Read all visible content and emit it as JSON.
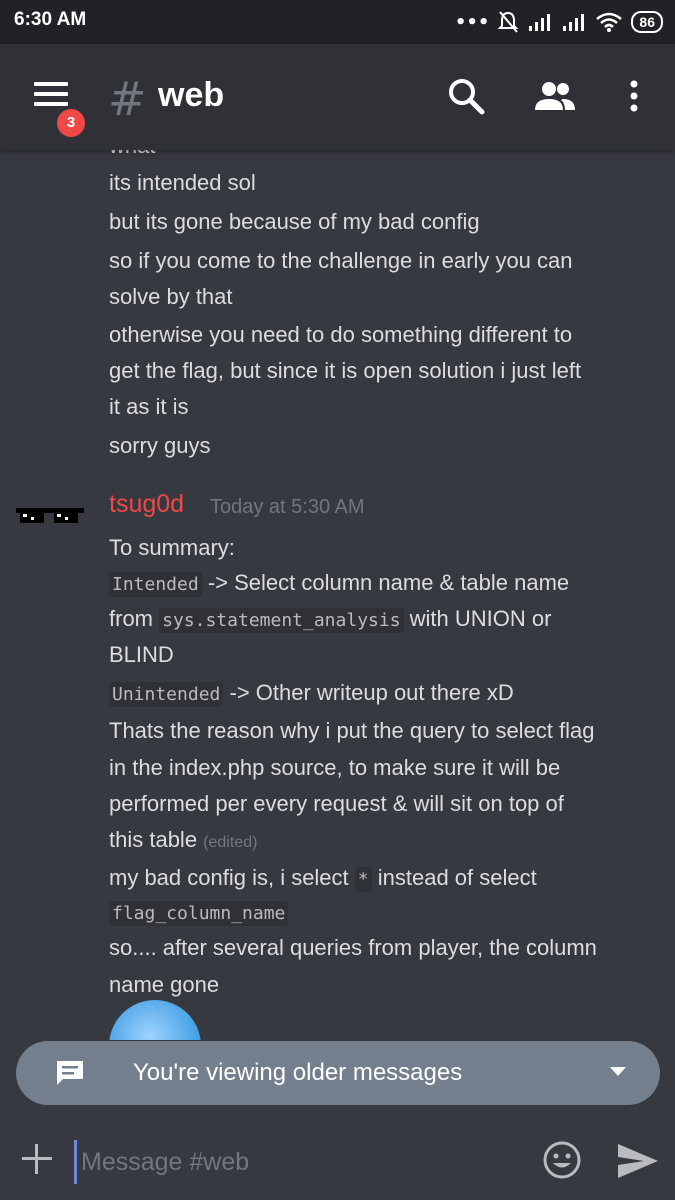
{
  "status_bar": {
    "time": "6:30 AM",
    "battery": "86"
  },
  "toolbar": {
    "badge_count": "3",
    "hash": "#",
    "channel": "web",
    "icons": [
      "menu-icon",
      "search-icon",
      "members-icon",
      "more-vertical-icon"
    ]
  },
  "messages": {
    "previous": {
      "lines": [
        "what",
        "its intended sol",
        "but its gone because of my bad config",
        "so if you come to the challenge in early you can",
        "solve by that",
        "otherwise you need to do something different to",
        "get the flag, but since it is open solution i just left",
        "it as it is",
        "sorry guys"
      ]
    },
    "group": {
      "author": "tsug0d",
      "timestamp": "Today at 5:30 AM",
      "lines": {
        "l1": "To summary:",
        "l2_code": "Intended",
        "l2_rest": " -> Select column name & table name",
        "l3_a": "from ",
        "l3_code": "sys.statement_analysis",
        "l3_b": " with UNION or",
        "l4": "BLIND",
        "l5_code": "Unintended",
        "l5_rest": " -> Other writeup out there xD",
        "l6": "Thats the reason why i put the query to select flag",
        "l7": "in the index.php source, to make sure it will be",
        "l8": "performed per every request & will sit on top of",
        "l9": "this table ",
        "l9_edited": "(edited)",
        "l10_a": "my bad config is, i select ",
        "l10_code": "*",
        "l10_b": " instead of select",
        "l11_code": "flag_column_name",
        "l12": "so.... after several queries from player, the column",
        "l13": "name gone"
      }
    }
  },
  "banner": {
    "text": "You're viewing older messages",
    "icon": "message-icon",
    "chevron": "chevron-down-icon"
  },
  "composer": {
    "placeholder": "Message #web",
    "icons": [
      "plus-icon",
      "emoji-icon",
      "send-icon"
    ]
  },
  "colors": {
    "background": "#36393f",
    "toolbar": "#2f3136",
    "author": "#f04747",
    "badge": "#f04747",
    "banner": "#747f8d"
  }
}
